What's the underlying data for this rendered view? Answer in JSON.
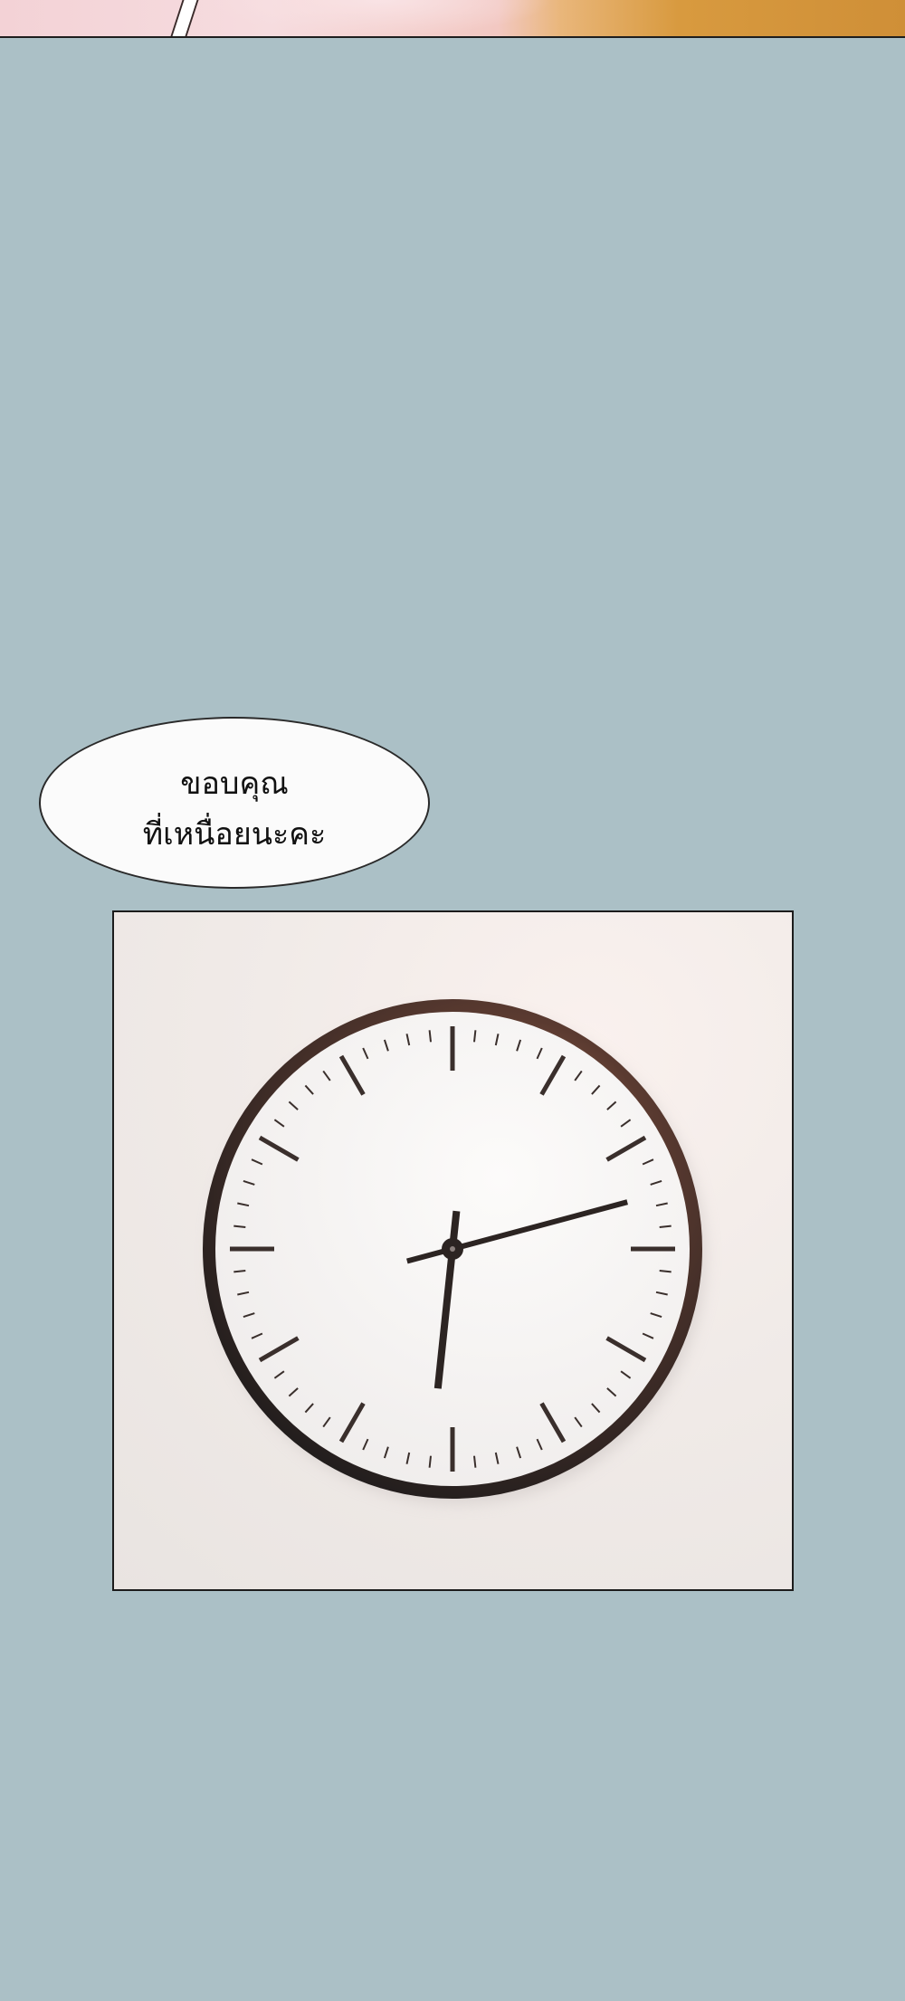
{
  "speech_bubble": {
    "text": "ขอบคุณ\nที่เหนื่อยนะคะ"
  },
  "clock": {
    "hour_hand_angle_deg": 186,
    "minute_hand_angle_deg": 75,
    "colors": {
      "rim": "#2b2422",
      "face": "#f7f4f2",
      "hands": "#2c2422"
    }
  },
  "colors": {
    "background": "#abc0c6"
  }
}
